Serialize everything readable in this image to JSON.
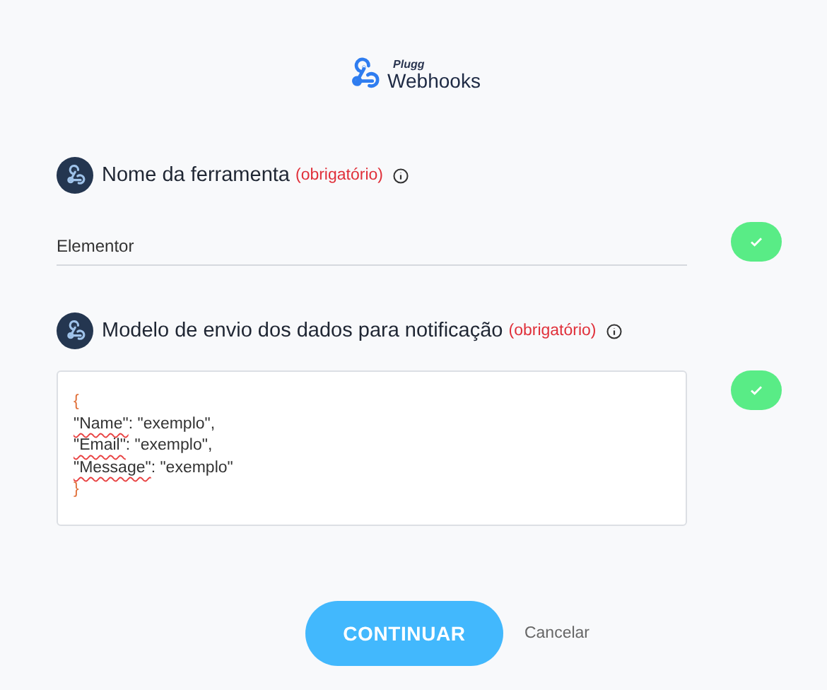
{
  "logo": {
    "brand": "Plugg",
    "product": "Webhooks"
  },
  "fields": [
    {
      "kind": "text",
      "label": "Nome da ferramenta",
      "required": "(obrigatório)",
      "value": "Elementor",
      "valid": true
    },
    {
      "kind": "code",
      "label": "Modelo de envio dos dados para notificação",
      "required": "(obrigatório)",
      "valid": true,
      "lines": [
        {
          "kind": "brace",
          "text": "{"
        },
        {
          "kind": "pair",
          "key": "\"Name\"",
          "rest": ": \"exemplo\","
        },
        {
          "kind": "pair",
          "key": "\"Email\"",
          "rest": ": \"exemplo\","
        },
        {
          "kind": "pair",
          "key": "\"Message\"",
          "rest": ": \"exemplo\""
        },
        {
          "kind": "brace",
          "text": "}"
        }
      ]
    }
  ],
  "actions": {
    "primary": "CONTINUAR",
    "secondary": "Cancelar"
  }
}
